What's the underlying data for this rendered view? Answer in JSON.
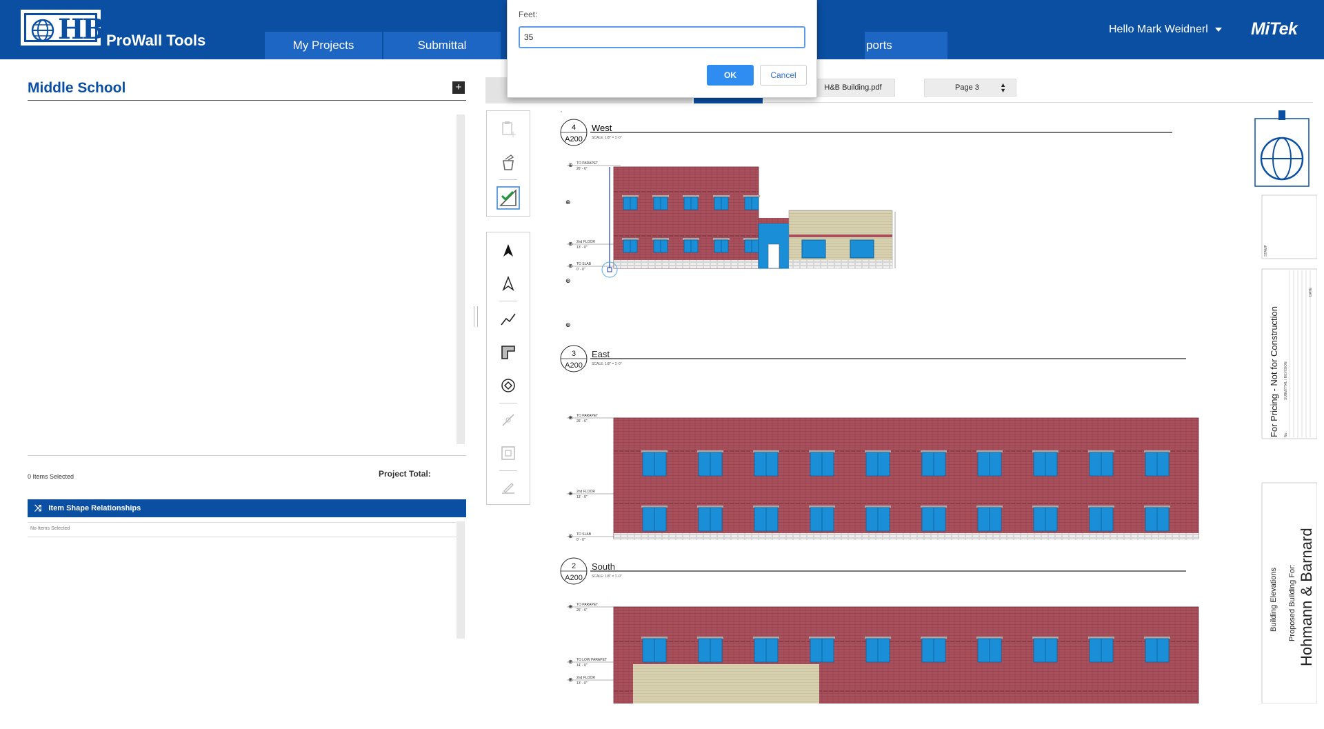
{
  "app": {
    "title": "ProWall Tools",
    "brand": "MiTek",
    "logo_text": "HB"
  },
  "nav": {
    "tabs": [
      {
        "label": "My Projects"
      },
      {
        "label": "Submittal"
      },
      {
        "label": "ports"
      }
    ]
  },
  "user": {
    "greeting": "Hello Mark Weidnerl"
  },
  "project": {
    "name": "Middle School",
    "add_symbol": "+",
    "items_selected": "0 Items Selected",
    "total_label": "Project Total:",
    "relationships_title": "Item Shape Relationships",
    "no_items": "No Items Selected"
  },
  "viewer": {
    "file_name": "H&B Building.pdf",
    "page": "Page 3"
  },
  "dialog": {
    "label": "Feet:",
    "value": "35",
    "ok": "OK",
    "cancel": "Cancel"
  },
  "drawing": {
    "views": [
      {
        "number": "4",
        "sheet": "A200",
        "title": "West",
        "scale": "SCALE:   1/8\" = 1'-0\"",
        "levels": [
          {
            "name": "TO PARAPET",
            "value": "26' - 6\""
          },
          {
            "name": "2nd FLOOR",
            "value": "13' - 0\""
          },
          {
            "name": "TO SLAB",
            "value": "0' - 0\""
          }
        ]
      },
      {
        "number": "3",
        "sheet": "A200",
        "title": "East",
        "scale": "SCALE:   1/8\" = 1'-0\"",
        "levels": [
          {
            "name": "TO PARAPET",
            "value": "26' - 6\""
          },
          {
            "name": "2nd FLOOR",
            "value": "13' - 0\""
          },
          {
            "name": "TO SLAB",
            "value": "0' - 0\""
          }
        ]
      },
      {
        "number": "2",
        "sheet": "A200",
        "title": "South",
        "scale": "SCALE:   1/8\" = 1'-0\"",
        "levels": [
          {
            "name": "TO PARAPET",
            "value": "26' - 6\""
          },
          {
            "name": "TO LOW PARAPET",
            "value": "14' - 0\""
          },
          {
            "name": "2nd FLOOR",
            "value": "13' - 0\""
          }
        ]
      }
    ],
    "title_block": {
      "stamp": "STAMP",
      "pricing_note": "For Pricing - Not for Construction",
      "submittal": "SUBMITTAL / REVISION",
      "date": "DATE",
      "no": "No.",
      "sheet_title": "Building Elevations",
      "proposed": "Proposed Building For:",
      "client": "Hohmann & Barnard"
    }
  },
  "colors": {
    "header": "#0b4fa3",
    "brick": "#a8505c",
    "window": "#1a8fd8",
    "stone": "#d6cfae",
    "ok": "#2f8df2"
  }
}
